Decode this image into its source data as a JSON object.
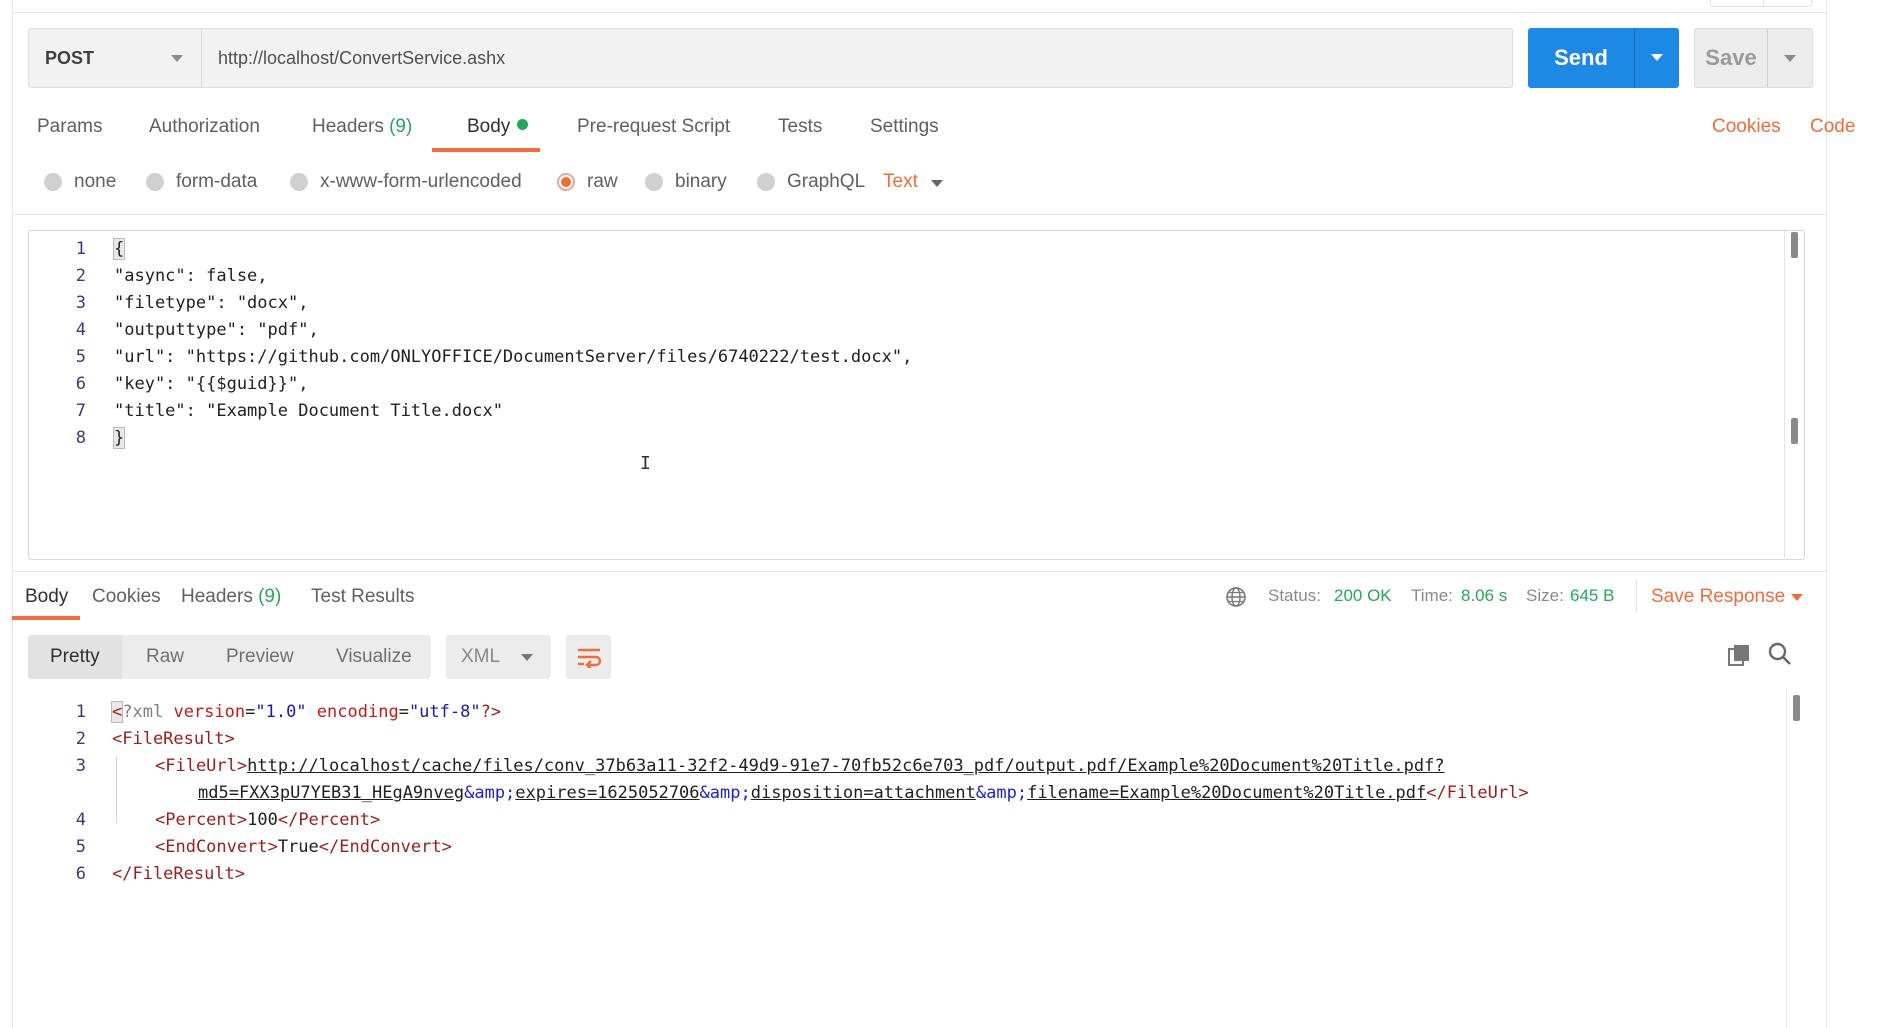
{
  "request": {
    "method": "POST",
    "url": "http://localhost/ConvertService.ashx",
    "send_label": "Send",
    "save_label": "Save"
  },
  "request_tabs": [
    {
      "label": "Params"
    },
    {
      "label": "Authorization"
    },
    {
      "label": "Headers",
      "count": "(9)"
    },
    {
      "label": "Body",
      "active": true
    },
    {
      "label": "Pre-request Script"
    },
    {
      "label": "Tests"
    },
    {
      "label": "Settings"
    }
  ],
  "right_links": {
    "cookies": "Cookies",
    "code": "Code"
  },
  "body_types": [
    {
      "label": "none"
    },
    {
      "label": "form-data"
    },
    {
      "label": "x-www-form-urlencoded"
    },
    {
      "label": "raw",
      "selected": true
    },
    {
      "label": "binary"
    },
    {
      "label": "GraphQL"
    }
  ],
  "raw_type": "Text",
  "editor_lines": [
    "{",
    "\"async\": false,",
    "\"filetype\": \"docx\",",
    "\"outputtype\": \"pdf\",",
    "\"url\": \"https://github.com/ONLYOFFICE/DocumentServer/files/6740222/test.docx\",",
    "\"key\": \"{{$guid}}\",",
    "\"title\": \"Example Document Title.docx\"",
    "}"
  ],
  "line_numbers": [
    "1",
    "2",
    "3",
    "4",
    "5",
    "6",
    "7",
    "8"
  ],
  "response_tabs": [
    {
      "label": "Body",
      "active": true
    },
    {
      "label": "Cookies"
    },
    {
      "label": "Headers",
      "count": "(9)"
    },
    {
      "label": "Test Results"
    }
  ],
  "status": {
    "status_label": "Status:",
    "status_value": "200 OK",
    "time_label": "Time:",
    "time_value": "8.06 s",
    "size_label": "Size:",
    "size_value": "645 B",
    "save_response": "Save Response"
  },
  "view_modes": [
    "Pretty",
    "Raw",
    "Preview",
    "Visualize"
  ],
  "format": "XML",
  "response_xml": {
    "decl_open": "<",
    "decl_name": "?xml",
    "attr1": "version",
    "val1": "\"1.0\"",
    "attr2": "encoding",
    "val2": "\"utf-8\"",
    "decl_close": "?>",
    "root_open": "<FileResult>",
    "fileurl_open": "<FileUrl>",
    "url_part1": "http://localhost/cache/files/conv_37b63a11-32f2-49d9-91e7-70fb52c6e703_pdf/output.pdf/Example%20Document%20Title.pdf?",
    "url_part2a": "md5=FXX3pU7YEB31_HEgA9nveg",
    "amp": "&amp;",
    "url_part2b": "expires=1625052706",
    "url_part2c": "disposition=attachment",
    "url_part2d": "filename=Example%20Document%20Title.pdf",
    "fileurl_close": "</FileUrl>",
    "percent_open": "<Percent>",
    "percent_value": "100",
    "percent_close": "</Percent>",
    "end_open": "<EndConvert>",
    "end_value": "True",
    "end_close": "</EndConvert>",
    "root_close": "</FileResult>"
  },
  "response_line_numbers": [
    "1",
    "2",
    "3",
    "4",
    "5",
    "6"
  ],
  "colors": {
    "accent": "#f26b3a",
    "send": "#1e88e5",
    "success": "#26a65b"
  }
}
